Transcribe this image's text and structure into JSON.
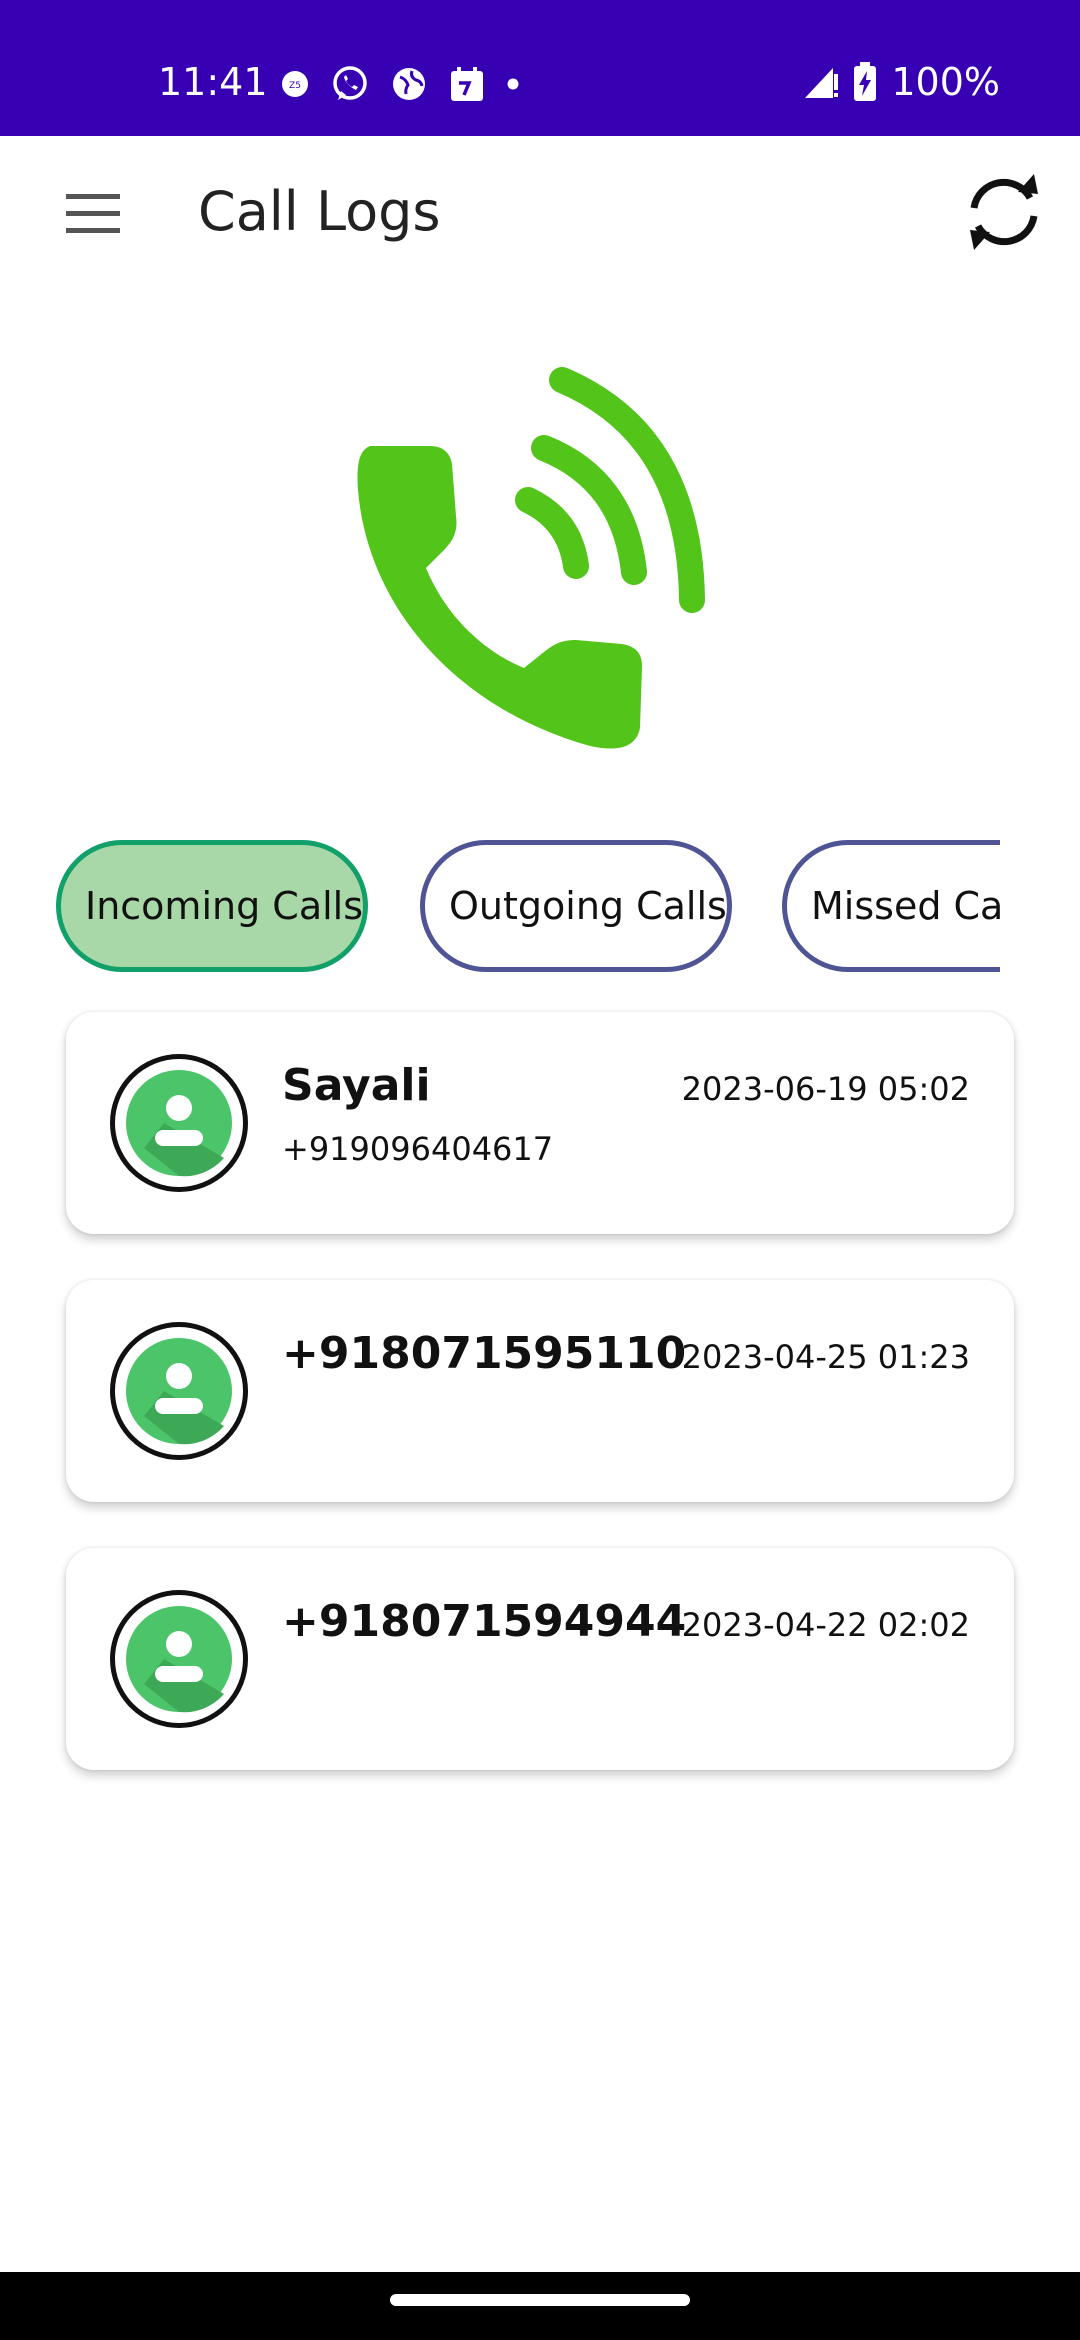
{
  "status_bar": {
    "time": "11:41",
    "battery": "100%",
    "icons": [
      "zee5-icon",
      "whatsapp-icon",
      "globe-icon",
      "calendar-icon",
      "dot-icon",
      "signal-icon",
      "battery-charging-icon"
    ]
  },
  "app_bar": {
    "title": "Call Logs",
    "menu_icon": "hamburger-menu-icon",
    "refresh_icon": "refresh-icon"
  },
  "hero": {
    "icon": "phone-ringing-icon",
    "color": "#52c41a"
  },
  "tabs": [
    {
      "label": "Incoming Calls",
      "selected": true
    },
    {
      "label": "Outgoing Calls",
      "selected": false
    },
    {
      "label": "Missed Calls",
      "selected": false
    }
  ],
  "calls": [
    {
      "name": "Sayali",
      "number": "+919096404617",
      "time": "2023-06-19 05:02"
    },
    {
      "name": "+918071595110",
      "number": "",
      "time": "2023-04-25 01:23"
    },
    {
      "name": "+918071594944",
      "number": "",
      "time": "2023-04-22 02:02"
    }
  ],
  "colors": {
    "status_bar": "#3700b3",
    "active_tab_fill": "#a8d8a8",
    "active_tab_border": "#12a06a",
    "tab_border": "#4f5594",
    "avatar_green": "#4cc56a"
  }
}
